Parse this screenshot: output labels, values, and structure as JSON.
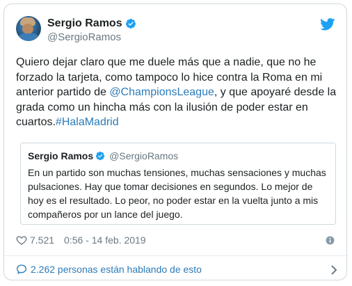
{
  "author": {
    "name": "Sergio Ramos",
    "handle": "@SergioRamos"
  },
  "tweet": {
    "text_1": "Quiero dejar claro que me duele más que a nadie, que no he forzado la tarjeta, como tampoco lo hice contra la Roma en mi anterior partido de ",
    "mention": "@ChampionsLeague",
    "text_2": ", y que apoyaré desde la grada como un hincha más con la ilusión de poder estar en cuartos.",
    "hashtag": "#HalaMadrid"
  },
  "quoted_tweet": {
    "name": "Sergio Ramos",
    "handle": "@SergioRamos",
    "text": "En un partido son muchas tensiones, muchas sensaciones y muchas pulsaciones. Hay que tomar decisiones en segundos. Lo mejor de hoy es el resultado. Lo peor, no poder estar en la vuelta junto a mis compañeros por un lance del juego."
  },
  "meta": {
    "likes": "7.521",
    "timestamp": "0:56 - 14 feb. 2019"
  },
  "footer": {
    "conversation": "2.262 personas están hablando de esto"
  },
  "icons": {
    "verified": "verified-badge-icon",
    "brand": "twitter-bird-icon",
    "like": "heart-icon",
    "info": "info-icon",
    "reply": "speech-bubble-icon",
    "more": "chevron-right-icon"
  },
  "colors": {
    "link": "#2b7bb9",
    "verified": "#1da1f2",
    "brand": "#1da1f2",
    "secondary_text": "#697882",
    "border": "#cfd9de"
  }
}
